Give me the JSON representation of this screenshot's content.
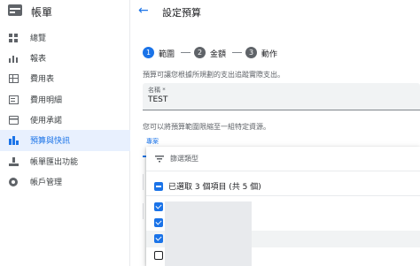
{
  "sidebar": {
    "title": "帳單",
    "items": [
      {
        "label": "總覽",
        "icon": "overview-grid-icon"
      },
      {
        "label": "報表",
        "icon": "bar-chart-icon"
      },
      {
        "label": "費用表",
        "icon": "table-icon"
      },
      {
        "label": "費用明細",
        "icon": "receipt-icon"
      },
      {
        "label": "使用承諾",
        "icon": "credit-card-icon"
      },
      {
        "label": "預算與快訊",
        "icon": "budget-icon",
        "active": true
      },
      {
        "label": "帳單匯出功能",
        "icon": "export-icon"
      },
      {
        "label": "帳戶管理",
        "icon": "gear-icon"
      }
    ]
  },
  "header": {
    "back_icon": "arrow-back-icon",
    "title": "設定預算"
  },
  "stepper": {
    "steps": [
      {
        "number": "1",
        "label": "範圍",
        "state": "active"
      },
      {
        "number": "2",
        "label": "金額",
        "state": "inactive"
      },
      {
        "number": "3",
        "label": "動作",
        "state": "inactive"
      }
    ]
  },
  "form": {
    "scope_description": "預算可讓您根據所規劃的支出追蹤實際支出。",
    "name_label": "名稱 *",
    "name_value": "TEST",
    "filter_description": "您可以將預算範圍限縮至一組特定資源。",
    "project_label": "專案"
  },
  "dropdown": {
    "filter_placeholder": "篩選類型",
    "select_all_label": "已選取 3 個項目 (共 5 個)",
    "options": [
      {
        "checked": true
      },
      {
        "checked": true
      },
      {
        "checked": true
      },
      {
        "checked": false
      }
    ]
  },
  "colors": {
    "accent": "#1a73e8",
    "active_bg": "#e8f0fe",
    "text": "#202124",
    "muted": "#5f6368"
  }
}
